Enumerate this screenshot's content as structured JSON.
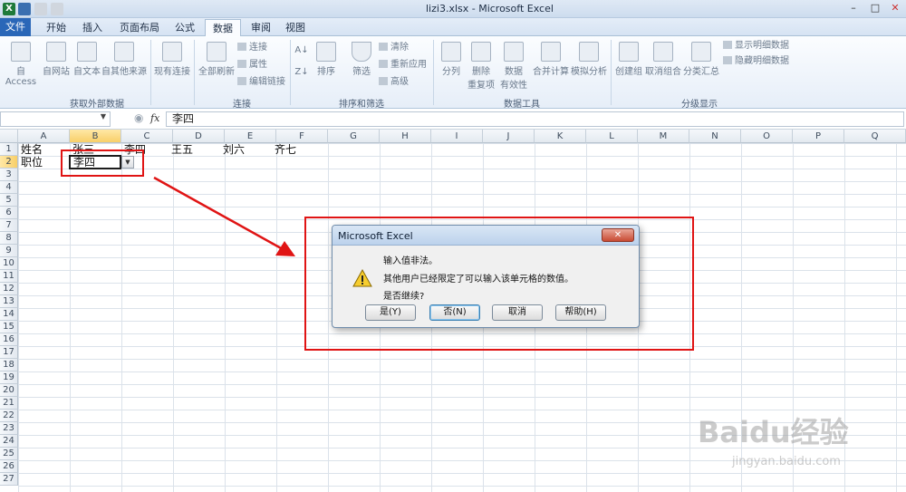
{
  "window": {
    "title": "lizi3.xlsx - Microsoft Excel",
    "minimize_icon": "minimize-icon",
    "maximize_icon": "maximize-icon",
    "close_icon": "close-icon"
  },
  "tabs": [
    {
      "label": "文件"
    },
    {
      "label": "开始"
    },
    {
      "label": "插入"
    },
    {
      "label": "页面布局"
    },
    {
      "label": "公式"
    },
    {
      "label": "数据"
    },
    {
      "label": "审阅"
    },
    {
      "label": "视图"
    }
  ],
  "ribbon": {
    "groups": [
      {
        "label": "获取外部数据"
      },
      {
        "label": "连接"
      },
      {
        "label": "排序和筛选"
      },
      {
        "label": "数据工具"
      },
      {
        "label": "分级显示"
      }
    ],
    "buttons": {
      "access": "自 Access",
      "web": "自网站",
      "text": "自文本",
      "other": "自其他来源",
      "existing": "现有连接",
      "refresh_all": "全部刷新",
      "connections": "连接",
      "properties": "属性",
      "edit_links": "编辑链接",
      "sort": "排序",
      "filter": "筛选",
      "clear": "清除",
      "reapply": "重新应用",
      "advanced": "高级",
      "text_to_columns": "分列",
      "remove_duplicates_1": "删除",
      "remove_duplicates_2": "重复项",
      "validation_1": "数据",
      "validation_2": "有效性",
      "consolidate": "合并计算",
      "what_if": "模拟分析",
      "group": "创建组",
      "ungroup": "取消组合",
      "subtotal": "分类汇总",
      "show_detail": "显示明细数据",
      "hide_detail": "隐藏明细数据"
    }
  },
  "formula_bar": {
    "fx": "fx",
    "value": "李四"
  },
  "columns": [
    "A",
    "B",
    "C",
    "D",
    "E",
    "F",
    "G",
    "H",
    "I",
    "J",
    "K",
    "L",
    "M",
    "N",
    "O",
    "P",
    "Q"
  ],
  "rows": [
    "1",
    "2",
    "3",
    "4",
    "5",
    "6",
    "7",
    "8",
    "9",
    "10",
    "11",
    "12",
    "13",
    "14",
    "15",
    "16",
    "17",
    "18",
    "19",
    "20",
    "21",
    "22",
    "23",
    "24",
    "25",
    "26",
    "27"
  ],
  "cells": {
    "A1": "姓名",
    "B1": "张三",
    "C1": "李四",
    "D1": "王五",
    "E1": "刘六",
    "F1": "齐七",
    "A2": "职位",
    "B2": "李四"
  },
  "dialog": {
    "title": "Microsoft Excel",
    "line1": "输入值非法。",
    "line2": "其他用户已经限定了可以输入该单元格的数值。",
    "line3": "是否继续?",
    "yes": "是(Y)",
    "no": "否(N)",
    "cancel": "取消",
    "help": "帮助(H)",
    "icon": "warning-icon"
  },
  "watermark": {
    "brand": "Baidu经验",
    "url": "jingyan.baidu.com"
  },
  "colors": {
    "highlight": "#e01414",
    "excel_green": "#1f7a3a",
    "file_tab": "#2a67b8"
  }
}
